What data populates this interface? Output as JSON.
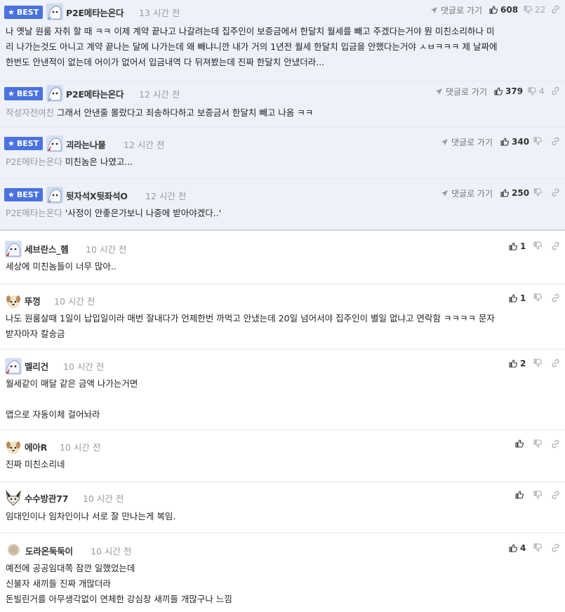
{
  "best_label": "BEST",
  "reply_label": "댓글로 가기",
  "comments": [
    {
      "nick": "P2E메타는온다",
      "time": "13 시간 전",
      "up": "608",
      "down": "22",
      "mention": "",
      "lines": [
        "나 옛날 원룸 자취 할 때 ㅋㅋ 이제 계약 끝나고 나갈려는데 집주인이 보증금에서 한달치 월세를 빼고 주겠다는거야 뭔 미친소리하나 미",
        "리 나가는것도 아니고 계약 끝나는 달에 나가는데 왜 빼냐니깐 내가 거의 1년전 월세 한달치 입금을 안했다는거야 ㅅㅂㅋㅋㅋ 제 날짜에",
        "한번도 안낸적이 없는데 어이가 없어서 입금내역 다 뒤져봤는데 진짜 한달치 안냈더라..."
      ]
    },
    {
      "nick": "P2E메타는온다",
      "time": "12 시간 전",
      "up": "379",
      "down": "4",
      "mention": "작성자전여친",
      "lines": [
        "그래서 안낸줄 몰랐다고 죄송하다하고 보증금서 한달치 빼고 나옴 ㅋㅋ"
      ]
    },
    {
      "nick": "괴라는나물",
      "time": "12 시간 전",
      "up": "340",
      "down": "",
      "mention": "P2E메타는온다",
      "lines": [
        "미친놈은 나였고..."
      ]
    },
    {
      "nick": "뒷자석X뒷좌석O",
      "time": "12 시간 전",
      "up": "250",
      "down": "",
      "mention": "P2E메타는온다",
      "lines": [
        "'사정이 안좋은가보니 나중에 받아야겠다..'"
      ]
    },
    {
      "nick": "세브란스_헴",
      "time": "10 시간 전",
      "up": "1",
      "down": "",
      "mention": "",
      "lines": [
        "세상에 미친놈들이 너무 많아.."
      ]
    },
    {
      "nick": "뚜껑",
      "time": "10 시간 전",
      "up": "1",
      "down": "",
      "mention": "",
      "lines": [
        "나도 원룸살때 1일이 납입일이라 매번 잘내다가 언제한번 까먹고 안냈는데 20일 넘어서야 집주인이 별일 없냐고 연락함 ㅋㅋㅋㅋ 문자",
        "받자마자 칼송금"
      ]
    },
    {
      "nick": "멜리건",
      "time": "10 시간 전",
      "up": "2",
      "down": "",
      "mention": "",
      "lines": [
        "월세같이 매달 같은 금액 나가는거면",
        "",
        "앱으로 자동이체 걸어놔라"
      ]
    },
    {
      "nick": "에아R",
      "time": "10 시간 전",
      "up": "",
      "down": "",
      "mention": "",
      "lines": [
        "진짜 미친소리네"
      ]
    },
    {
      "nick": "수수방관77",
      "time": "10 시간 전",
      "up": "",
      "down": "",
      "mention": "",
      "lines": [
        "임대인이나 임차인이나 서로 잘 만나는게 복임."
      ]
    },
    {
      "nick": "도라온둑둑이",
      "time": "10 시간 전",
      "up": "4",
      "down": "",
      "mention": "",
      "lines": [
        "예전에 공공임대쪽 잠깐 일했었는데",
        "신불자 새끼들 진짜 개많더라",
        "돈빌린거를 아무생각없이 연체한 강심장 새끼들 개많구나 느낌"
      ]
    }
  ]
}
